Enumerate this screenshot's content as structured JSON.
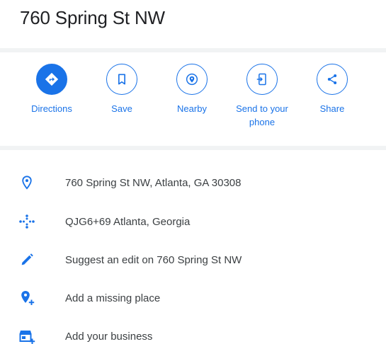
{
  "place": {
    "title": "760 Spring St NW"
  },
  "actions": [
    {
      "label": "Directions",
      "icon": "directions-icon"
    },
    {
      "label": "Save",
      "icon": "bookmark-icon"
    },
    {
      "label": "Nearby",
      "icon": "nearby-icon"
    },
    {
      "label": "Send to your phone",
      "icon": "send-to-phone-icon"
    },
    {
      "label": "Share",
      "icon": "share-icon"
    }
  ],
  "details": [
    {
      "text": "760 Spring St NW, Atlanta, GA 30308",
      "icon": "location-pin-icon"
    },
    {
      "text": "QJG6+69 Atlanta, Georgia",
      "icon": "plus-code-icon"
    },
    {
      "text": "Suggest an edit on 760 Spring St NW",
      "icon": "pencil-icon"
    },
    {
      "text": "Add a missing place",
      "icon": "add-place-icon"
    },
    {
      "text": "Add your business",
      "icon": "add-business-icon"
    }
  ],
  "colors": {
    "accent": "#1a73e8",
    "divider": "#f1f3f4",
    "text": "#3c4043"
  }
}
